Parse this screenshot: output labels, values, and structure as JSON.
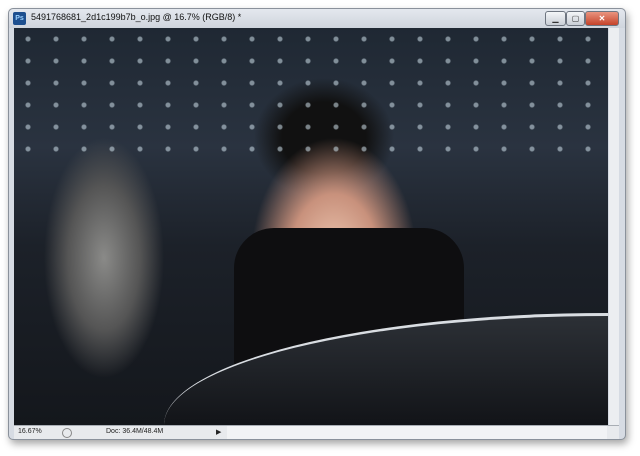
{
  "window": {
    "title": "5491768681_2d1c199b7b_o.jpg @ 16.7% (RGB/8) *",
    "app_icon": "Ps"
  },
  "controls": {
    "minimize": "▁",
    "maximize": "▢",
    "close": "✕"
  },
  "status": {
    "zoom": "16.67%",
    "doc": "Doc: 36.4M/48.4M",
    "arrow": "▶"
  }
}
